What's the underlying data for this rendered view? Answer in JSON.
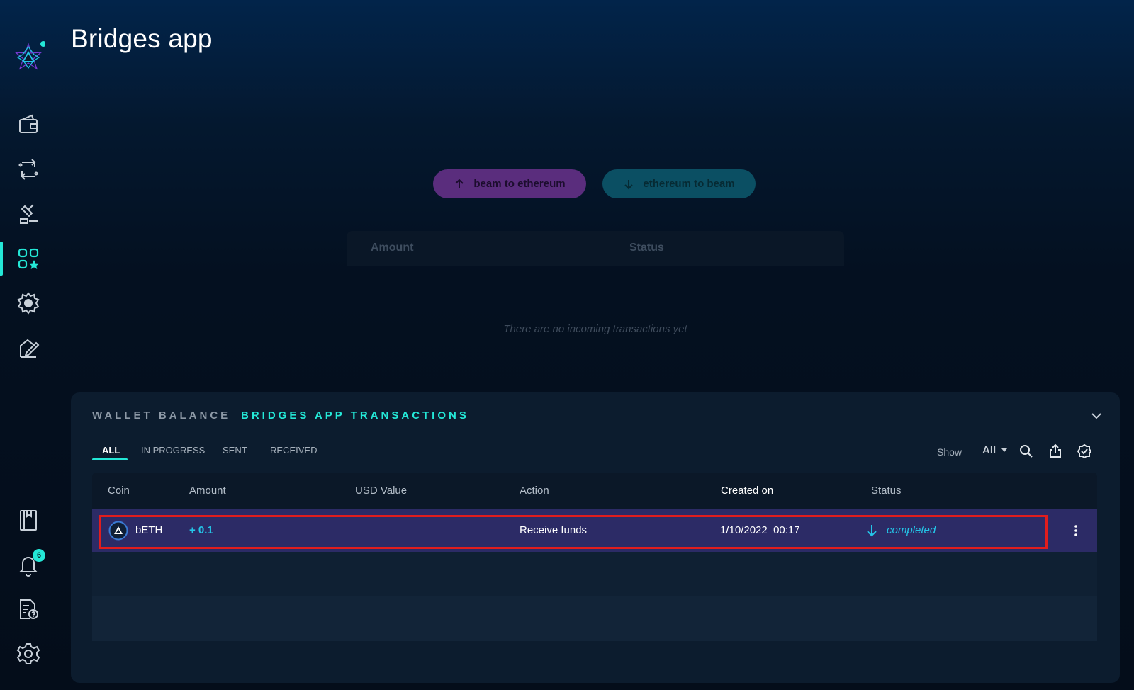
{
  "app": {
    "title": "Bridges app"
  },
  "sidebar": {
    "items": [
      {
        "name": "wallet",
        "icon": "wallet-icon"
      },
      {
        "name": "atomic-swaps",
        "icon": "swap-icon"
      },
      {
        "name": "dao",
        "icon": "gavel-icon"
      },
      {
        "name": "dapps",
        "icon": "apps-star-icon",
        "active": true
      },
      {
        "name": "beamx",
        "icon": "gear-badge-icon"
      },
      {
        "name": "voting",
        "icon": "vote-icon"
      },
      {
        "name": "address-book",
        "icon": "book-icon"
      },
      {
        "name": "notifications",
        "icon": "bell-icon",
        "badge": "6"
      },
      {
        "name": "help",
        "icon": "help-doc-icon"
      },
      {
        "name": "settings",
        "icon": "settings-icon"
      }
    ]
  },
  "bridge": {
    "beam_to_eth_label": "beam to ethereum",
    "eth_to_beam_label": "ethereum to beam",
    "table_headers": [
      "Amount",
      "Status"
    ],
    "empty_message": "There are no incoming transactions yet"
  },
  "panel": {
    "tab_wallet": "WALLET BALANCE",
    "tab_bridges": "BRIDGES APP TRANSACTIONS",
    "filters": [
      "ALL",
      "IN PROGRESS",
      "SENT",
      "RECEIVED"
    ],
    "active_filter": "ALL",
    "show_label": "Show",
    "show_value": "All",
    "columns": [
      "Coin",
      "Amount",
      "USD Value",
      "Action",
      "Created on",
      "Status"
    ],
    "rows": [
      {
        "coin": "bETH",
        "amount": "+ 0.1",
        "usd_value": "",
        "action": "Receive funds",
        "created_on": "1/10/2022  00:17",
        "status": "completed"
      }
    ]
  },
  "colors": {
    "accent": "#24e8d7",
    "beam_purple": "#5a2d7d",
    "eth_teal": "#0b4f63",
    "highlight_red": "#e11d1d",
    "status_blue": "#24c6e8"
  }
}
